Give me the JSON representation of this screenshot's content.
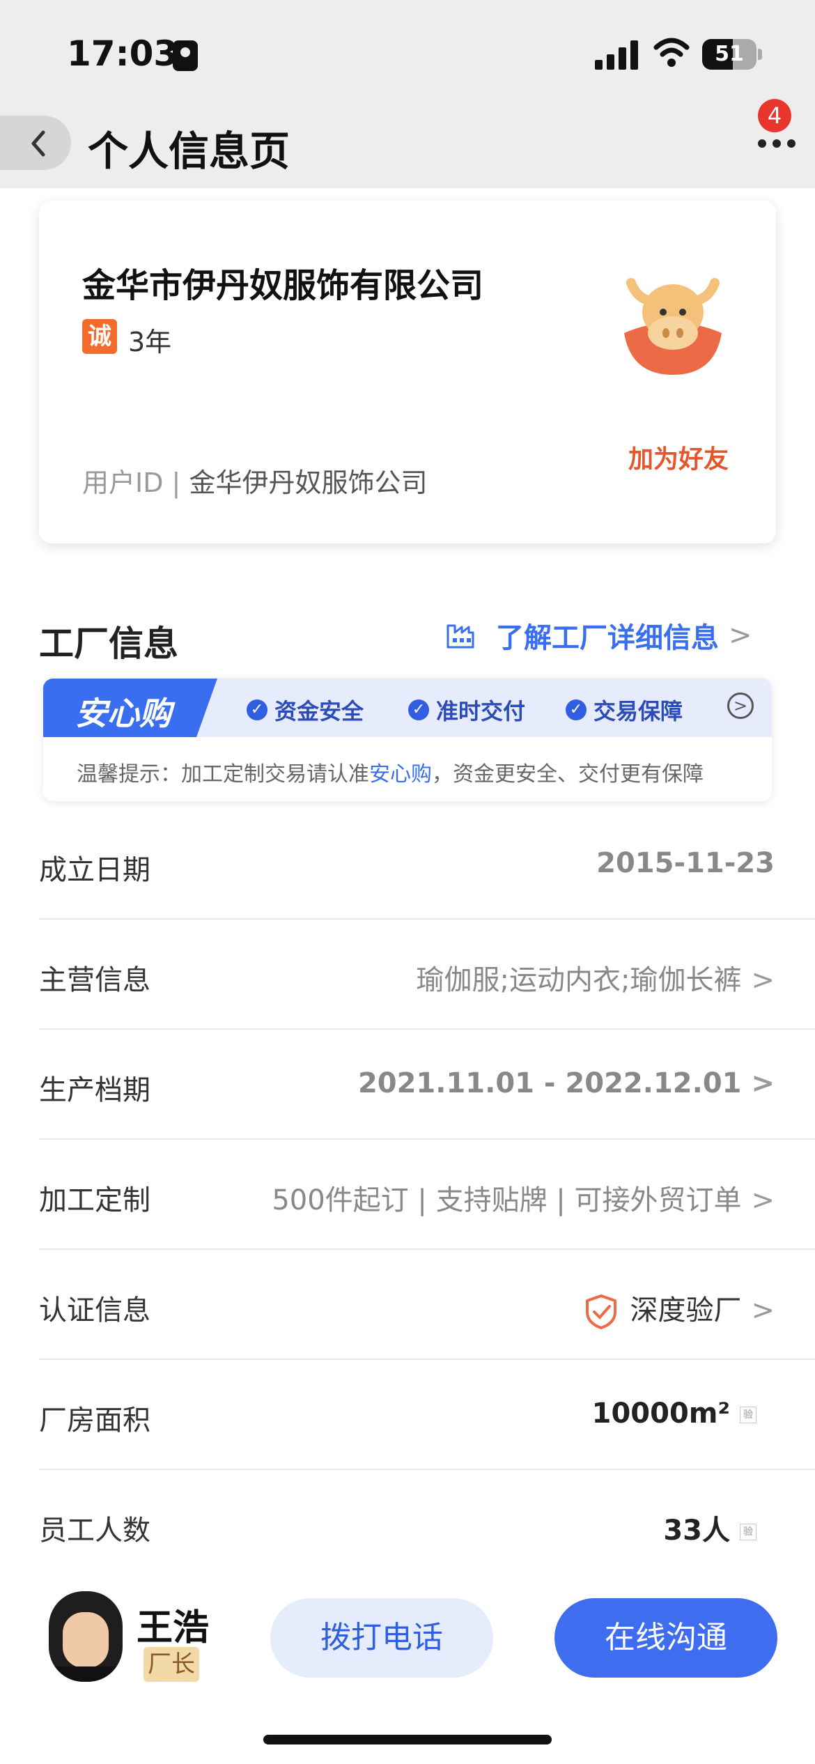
{
  "status_bar": {
    "time": "17:03",
    "battery": "51"
  },
  "header": {
    "title": "个人信息页",
    "notification_count": "4"
  },
  "company": {
    "name": "金华市伊丹奴服饰有限公司",
    "trust_badge": "诚",
    "years": "3年",
    "add_friend": "加为好友",
    "user_id_label": "用户ID |",
    "user_id_value": "金华伊丹奴服饰公司"
  },
  "factory": {
    "section_title": "工厂信息",
    "detail_link": "了解工厂详细信息",
    "assurance": {
      "logo": "安心购",
      "guarantees": [
        "资金安全",
        "准时交付",
        "交易保障"
      ],
      "tip_prefix": "温馨提示：加工定制交易请认准",
      "tip_highlight": "安心购",
      "tip_suffix": "，资金更安全、交付更有保障"
    },
    "rows": [
      {
        "label": "成立日期",
        "value": "2015-11-23"
      },
      {
        "label": "主营信息",
        "value": "瑜伽服;运动内衣;瑜伽长裤"
      },
      {
        "label": "生产档期",
        "value": "2021.11.01 - 2022.12.01"
      },
      {
        "label": "加工定制",
        "value": "500件起订 | 支持贴牌 | 可接外贸订单"
      },
      {
        "label": "认证信息",
        "value": "深度验厂"
      },
      {
        "label": "厂房面积",
        "value": "10000m²"
      },
      {
        "label": "员工人数",
        "value": "33人"
      }
    ],
    "verify_mark": "验"
  },
  "contact": {
    "name": "王浩",
    "role": "厂长",
    "call_label": "拨打电话",
    "chat_label": "在线沟通"
  },
  "colors": {
    "accent_blue": "#3f6df0",
    "accent_orange": "#e2572c",
    "badge_red": "#e8362c"
  }
}
